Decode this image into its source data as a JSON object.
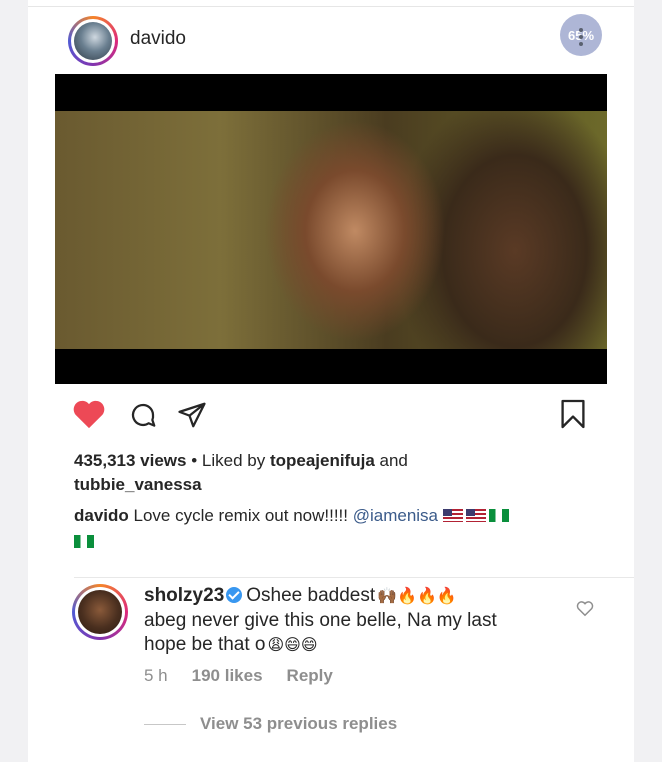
{
  "post": {
    "username": "davido",
    "percent_badge": "65%",
    "views_count": "435,313 views",
    "liked_by_prefix": " • Liked by ",
    "liked_by_user1": "topeajenifuja",
    "liked_by_and": " and",
    "liked_by_user2": "tubbie_vanessa",
    "caption_user": "davido",
    "caption_text": " Love cycle remix out now!!!!! ",
    "caption_mention": "@iamenisa"
  },
  "comment": {
    "username": "sholzy23",
    "text_part1": "Oshee baddest",
    "emoji1": "🙌🏾🔥🔥🔥",
    "text_part2": "abeg never give this one belle, Na my last hope be that o",
    "emoji2": "😩😄😄",
    "time": "5 h",
    "likes": "190 likes",
    "reply_label": "Reply"
  },
  "replies": {
    "label": "View 53 previous replies"
  },
  "colors": {
    "heart": "#ed4956",
    "link": "#3b5b8a",
    "muted": "#8e8e8e",
    "verified": "#3897f0"
  },
  "icons": [
    "more-icon",
    "heart-icon",
    "comment-icon",
    "share-icon",
    "bookmark-icon",
    "verified-icon",
    "like-icon"
  ]
}
